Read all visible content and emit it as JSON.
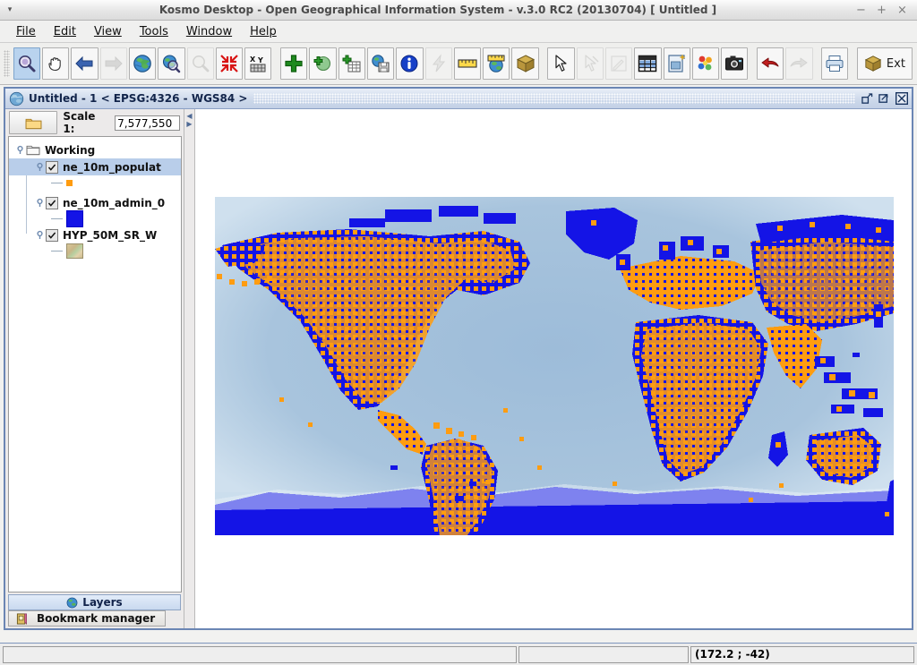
{
  "window": {
    "title": "Kosmo Desktop - Open Geographical Information System - v.3.0 RC2 (20130704)  [ Untitled ]",
    "menu_arrow": "▾",
    "minimize": "−",
    "maximize": "+",
    "close": "×"
  },
  "menubar": {
    "items": [
      {
        "label": "File",
        "mnemonic": "F"
      },
      {
        "label": "Edit",
        "mnemonic": "E"
      },
      {
        "label": "View",
        "mnemonic": "V"
      },
      {
        "label": "Tools",
        "mnemonic": "T"
      },
      {
        "label": "Window",
        "mnemonic": "W"
      },
      {
        "label": "Help",
        "mnemonic": "H"
      }
    ]
  },
  "toolbar": {
    "buttons": [
      {
        "name": "zoom-in-tool",
        "icon": "magnifier-icon",
        "state": "active"
      },
      {
        "name": "pan-tool",
        "icon": "hand-icon",
        "state": "normal"
      },
      {
        "name": "back-extent",
        "icon": "arrow-left-icon",
        "state": "normal"
      },
      {
        "name": "forward-extent",
        "icon": "arrow-right-icon",
        "state": "disabled"
      },
      {
        "name": "zoom-full-extent",
        "icon": "globe-icon",
        "state": "normal"
      },
      {
        "name": "zoom-to-layer",
        "icon": "globe-magnifier-icon",
        "state": "normal"
      },
      {
        "name": "zoom-to-selected",
        "icon": "magnifier-grey-icon",
        "state": "disabled"
      },
      {
        "name": "zoom-to-fit",
        "icon": "arrows-inward-icon",
        "state": "normal"
      },
      {
        "name": "goto-xy",
        "icon": "xy-coordinate-icon",
        "state": "normal"
      },
      {
        "name": "add-layer",
        "icon": "plus-green-icon",
        "state": "normal"
      },
      {
        "name": "add-wms-layer",
        "icon": "globe-plus-icon",
        "state": "normal"
      },
      {
        "name": "add-table-layer",
        "icon": "table-plus-icon",
        "state": "normal"
      },
      {
        "name": "save-layer",
        "icon": "save-globe-icon",
        "state": "normal"
      },
      {
        "name": "feature-info",
        "icon": "info-icon",
        "state": "normal"
      },
      {
        "name": "flash-feature",
        "icon": "lightning-icon",
        "state": "disabled"
      },
      {
        "name": "measure-distance",
        "icon": "ruler-icon",
        "state": "normal"
      },
      {
        "name": "measure-geodetic",
        "icon": "globe-ruler-icon",
        "state": "normal"
      },
      {
        "name": "package-tool",
        "icon": "box-icon",
        "state": "normal"
      },
      {
        "name": "select-tool",
        "icon": "cursor-arrow-icon",
        "state": "normal"
      },
      {
        "name": "deselect-tool",
        "icon": "cursor-deselect-icon",
        "state": "disabled"
      },
      {
        "name": "edit-geometry",
        "icon": "edit-pencil-icon",
        "state": "disabled"
      },
      {
        "name": "attribute-table",
        "icon": "grid-table-icon",
        "state": "normal"
      },
      {
        "name": "new-layout",
        "icon": "layout-new-icon",
        "state": "normal"
      },
      {
        "name": "symbology",
        "icon": "color-dots-icon",
        "state": "normal"
      },
      {
        "name": "screenshot",
        "icon": "camera-icon",
        "state": "normal"
      },
      {
        "name": "undo",
        "icon": "undo-arrow-icon",
        "state": "normal"
      },
      {
        "name": "redo",
        "icon": "redo-arrow-icon",
        "state": "disabled"
      },
      {
        "name": "print",
        "icon": "printer-icon",
        "state": "normal"
      },
      {
        "name": "extensions",
        "icon": "box-icon",
        "state": "normal",
        "label": "Ext"
      }
    ]
  },
  "mdi": {
    "title": "Untitled - 1 < EPSG:4326 - WGS84 >",
    "icon": "globe-icon",
    "restore": "restore-icon",
    "maximize": "maximize-icon",
    "close": "close-icon"
  },
  "scale": {
    "label": "Scale 1:",
    "value": "7,577,550",
    "folder_icon": "folder-icon"
  },
  "layers": {
    "root": {
      "label": "Working",
      "icon": "folder-open-icon",
      "expander": "⊖"
    },
    "items": [
      {
        "label": "ne_10m_populat",
        "checked": true,
        "selected": true,
        "swatch": "orange-point"
      },
      {
        "label": "ne_10m_admin_0",
        "checked": true,
        "selected": false,
        "swatch": "blue-polygon"
      },
      {
        "label": "HYP_50M_SR_W",
        "checked": true,
        "selected": false,
        "swatch": "raster-thumb"
      }
    ],
    "checkmark": "✔"
  },
  "panel_tabs": [
    {
      "label": "Layers",
      "icon": "globe-icon",
      "active": true
    },
    {
      "label": "Bookmark manager",
      "icon": "bookmark-icon",
      "active": false
    }
  ],
  "splitter": {
    "collapse_left": "◀",
    "collapse_right": "▶"
  },
  "statusbar": {
    "message": "",
    "secondary": "",
    "coordinates": "(172.2 ; -42)"
  },
  "map": {
    "ocean_color": "#9fbdd9",
    "land_color": "#1414e6",
    "point_color": "#ff9c10",
    "background": "#ffffff",
    "haze_color": "#cfe0ee"
  }
}
